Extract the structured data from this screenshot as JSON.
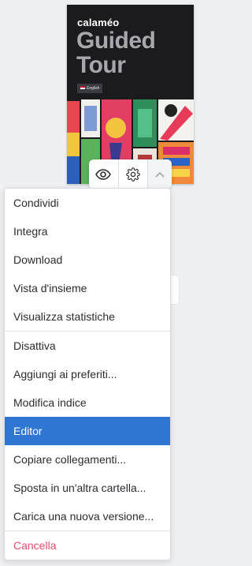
{
  "cover": {
    "brand": "calaméo",
    "title_line1": "Guided",
    "title_line2": "Tour",
    "language": "English"
  },
  "cover_actions": {
    "preview_icon": "eye-icon",
    "settings_icon": "gear-icon",
    "collapse_icon": "chevron-up-icon"
  },
  "menu": {
    "groups": [
      [
        "Condividi",
        "Integra",
        "Download",
        "Vista d'insieme",
        "Visualizza statistiche"
      ],
      [
        "Disattiva",
        "Aggiungi ai preferiti...",
        "Modifica indice",
        "Editor",
        "Copiare collegamenti...",
        "Sposta in un'altra cartella...",
        "Carica una nuova versione..."
      ],
      [
        "Cancella"
      ]
    ],
    "active_item": "Editor",
    "danger_item": "Cancella"
  },
  "colors": {
    "accent": "#2f76d2",
    "danger": "#e04f6d",
    "cover_bg": "#1b1b1d"
  }
}
